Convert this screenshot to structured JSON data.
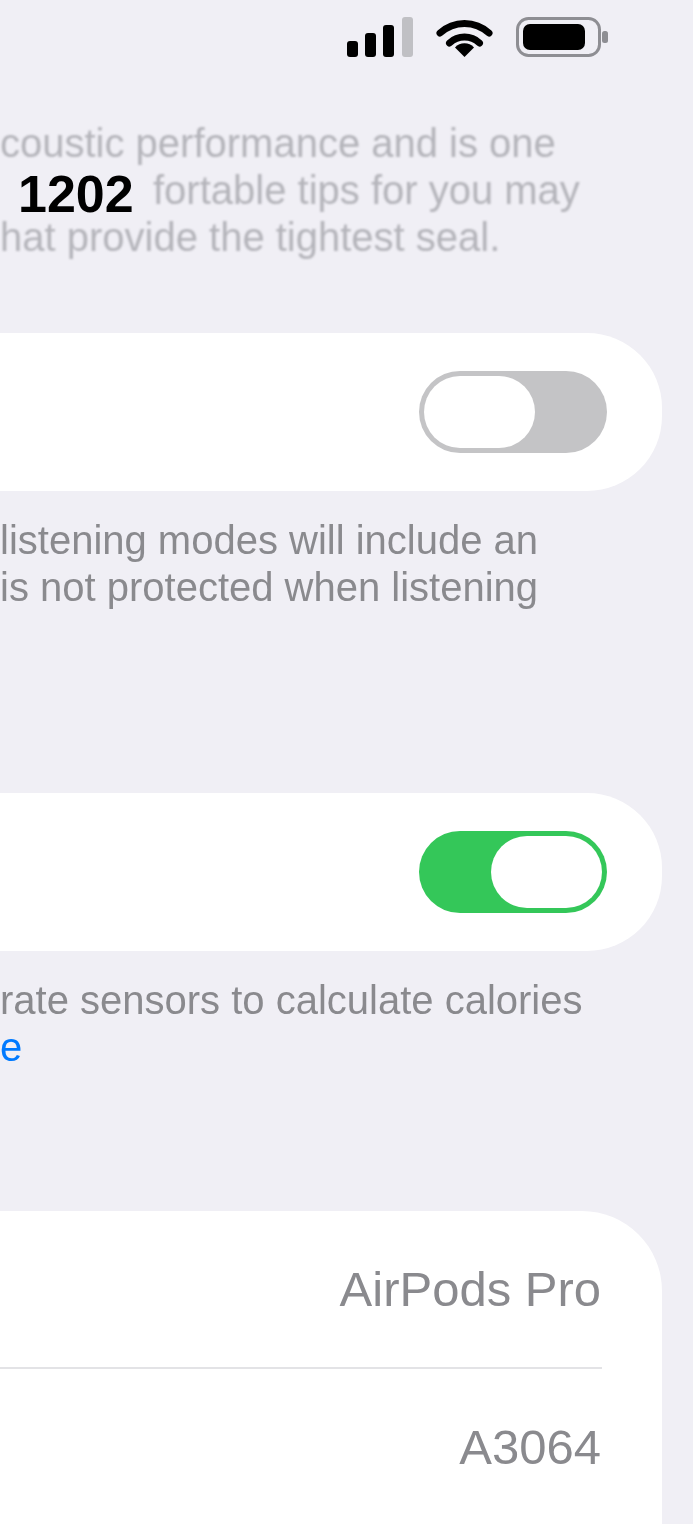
{
  "status_bar": {
    "time": "1202"
  },
  "blurred_text": {
    "lines": [
      "coustic performance and is one",
      "fortable tips for you may",
      "hat provide the tightest seal."
    ]
  },
  "sections": [
    {
      "toggle": {
        "on": false
      },
      "footer": {
        "lines": [
          "listening modes will include an",
          "is not protected when listening"
        ]
      }
    },
    {
      "toggle": {
        "on": true
      },
      "footer": {
        "lines": [
          "rate sensors to calculate calories"
        ],
        "link": "e"
      }
    }
  ],
  "info_rows": [
    {
      "value": "AirPods Pro"
    },
    {
      "value": "A3064"
    }
  ]
}
